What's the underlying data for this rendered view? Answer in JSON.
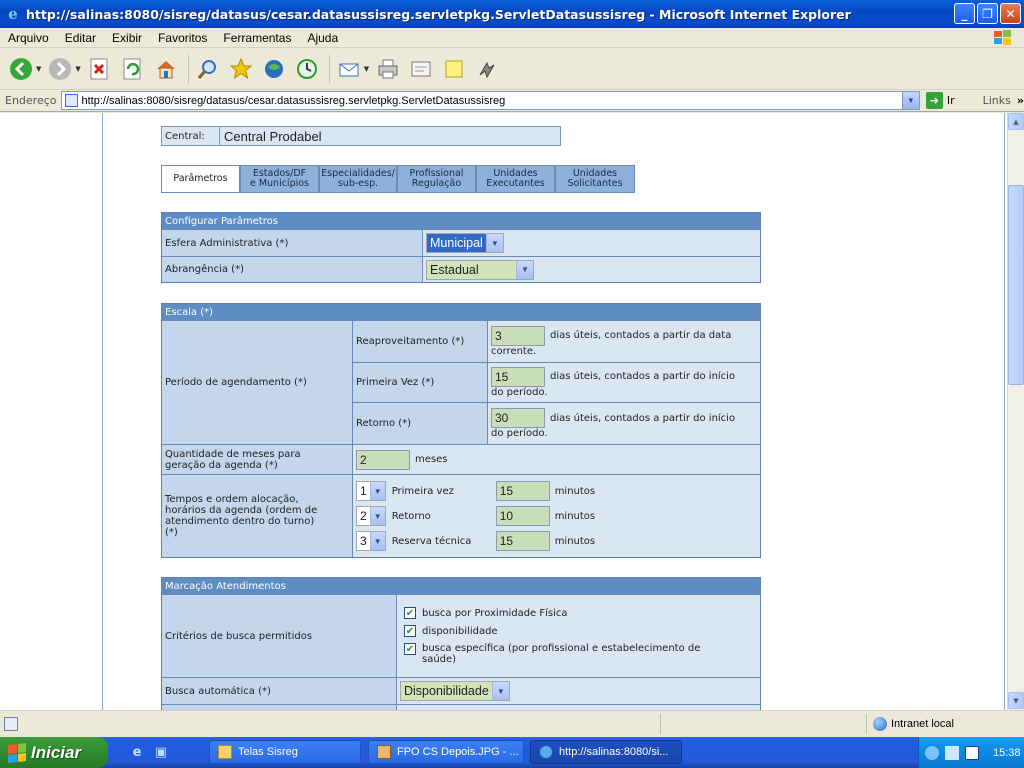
{
  "window": {
    "title": "http://salinas:8080/sisreg/datasus/cesar.datasussisreg.servletpkg.ServletDatasussisreg - Microsoft Internet Explorer"
  },
  "menu": [
    "Arquivo",
    "Editar",
    "Exibir",
    "Favoritos",
    "Ferramentas",
    "Ajuda"
  ],
  "address": {
    "label": "Endereço",
    "url": "http://salinas:8080/sisreg/datasus/cesar.datasussisreg.servletpkg.ServletDatasussisreg",
    "go": "Ir",
    "links": "Links"
  },
  "page": {
    "central_label": "Central:",
    "central_value": "Central Prodabel",
    "tabs": [
      {
        "l1": "Parâmetros",
        "l2": ""
      },
      {
        "l1": "Estados/DF",
        "l2": "e Municípios"
      },
      {
        "l1": "Especialidades/",
        "l2": "sub-esp."
      },
      {
        "l1": "Profissional",
        "l2": "Regulação"
      },
      {
        "l1": "Unidades",
        "l2": "Executantes"
      },
      {
        "l1": "Unidades",
        "l2": "Solicitantes"
      }
    ],
    "config": {
      "title": "Configurar Parâmetros",
      "esfera_label": "Esfera Administrativa (*)",
      "esfera_value": "Municipal",
      "abrangencia_label": "Abrangência (*)",
      "abrangencia_value": "Estadual"
    },
    "escala": {
      "title": "Escala (*)",
      "periodo_label": "Período de agendamento (*)",
      "reaprov_label": "Reaproveitamento (*)",
      "reaprov_value": "3",
      "reaprov_text1": "dias úteis, contados a partir da data",
      "reaprov_text2": "corrente.",
      "primeira_label": "Primeira Vez (*)",
      "primeira_value": "15",
      "primeira_text1": "dias úteis, contados a partir do início",
      "primeira_text2": "do período.",
      "retorno_label": "Retorno (*)",
      "retorno_value": "30",
      "retorno_text1": "dias úteis, contados a partir do início",
      "retorno_text2": "do período.",
      "meses_label1": "Quantidade de meses para",
      "meses_label2": "geração da agenda (*)",
      "meses_value": "2",
      "meses_unit": "meses",
      "tempos_label1": "Tempos e ordem alocação,",
      "tempos_label2": "horários da agenda (ordem de",
      "tempos_label3": "atendimento dentro do turno)",
      "tempos_label4": "(*)",
      "tempos": [
        {
          "ordem": "1",
          "label": "Primeira vez",
          "value": "15",
          "unit": "minutos"
        },
        {
          "ordem": "2",
          "label": "Retorno",
          "value": "10",
          "unit": "minutos"
        },
        {
          "ordem": "3",
          "label": "Reserva técnica",
          "value": "15",
          "unit": "minutos"
        }
      ]
    },
    "marcacao": {
      "title": "Marcação Atendimentos",
      "criterios_label": "Critérios de busca permitidos",
      "criterios": [
        {
          "text": "busca por Proximidade Física"
        },
        {
          "text": "disponibilidade"
        },
        {
          "text": "busca específica (por profissional e estabelecimento de"
        },
        {
          "text": "saúde)"
        }
      ],
      "busca_label": "Busca automática (*)",
      "busca_value": "Disponibilidade"
    }
  },
  "status": {
    "zone": "Intranet local"
  },
  "taskbar": {
    "start": "Iniciar",
    "tasks": [
      "Telas Sisreg",
      "FPO CS Depois.JPG - ...",
      "http://salinas:8080/si..."
    ],
    "clock": "15:38"
  },
  "colors": {
    "panel_header": "#5e8dc3",
    "cell_bg": "#dbe6f3",
    "label_bg": "#c4d6ec",
    "input_bg": "#c9ddb8"
  }
}
